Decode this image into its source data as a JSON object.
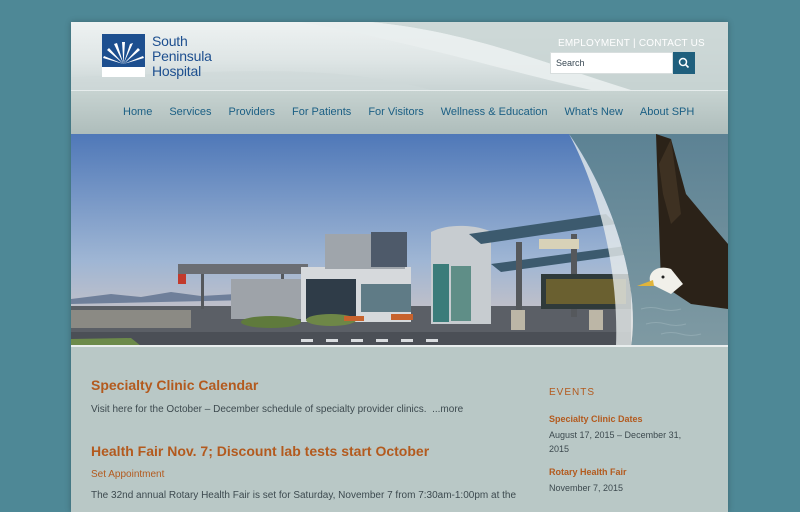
{
  "header": {
    "logo_lines": [
      "South",
      "Peninsula",
      "Hospital"
    ],
    "employment_link": "EMPLOYMENT",
    "separator": "|",
    "contact_link": "CONTACT US",
    "search_placeholder": "Search"
  },
  "nav": {
    "items": [
      "Home",
      "Services",
      "Providers",
      "For Patients",
      "For Visitors",
      "Wellness & Education",
      "What's New",
      "About SPH"
    ]
  },
  "posts": [
    {
      "title": "Specialty Clinic Calendar",
      "body": "Visit here for the October – December schedule of specialty provider clinics.",
      "more": "...more"
    },
    {
      "title": "Health Fair Nov. 7; Discount lab tests start October",
      "subtitle": "Set Appointment",
      "body": "The 32nd annual Rotary Health Fair is set for Saturday, November 7 from 7:30am-1:00pm at the"
    }
  ],
  "sidebar": {
    "heading": "EVENTS",
    "events": [
      {
        "title": "Specialty Clinic Dates",
        "date": "August 17, 2015 – December 31, 2015"
      },
      {
        "title": "Rotary Health Fair",
        "date": "November 7, 2015"
      }
    ]
  },
  "colors": {
    "background": "#4e8896",
    "accent_orange": "#b35a1e",
    "nav_blue": "#1b5f84",
    "brand_blue": "#1d4f8f"
  }
}
